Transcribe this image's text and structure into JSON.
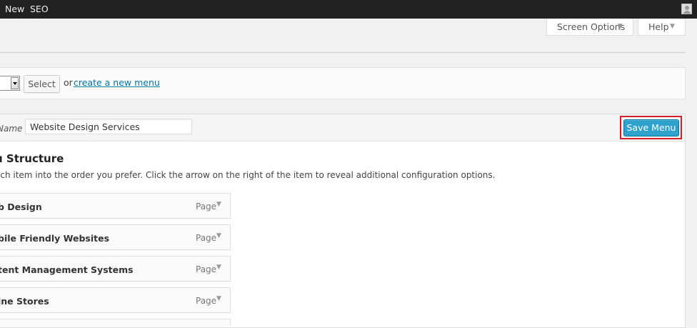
{
  "admin_bar": {
    "items": [
      "New",
      "SEO"
    ]
  },
  "screen_meta": {
    "screen_options_label": "Screen Options",
    "help_label": "Help",
    "arrow_glyph": "▼"
  },
  "manage": {
    "select_button_label": "Select",
    "or_text": "or",
    "create_link_text": "create a new menu",
    "period": "."
  },
  "editor": {
    "name_label": "Name",
    "menu_name_value": "Website Design Services",
    "save_button_label": "Save Menu",
    "structure_title": "u Structure",
    "instructions": "ach item into the order you prefer. Click the arrow on the right of the item to reveal additional configuration options.",
    "items": [
      {
        "title": "b Design",
        "type": "Page"
      },
      {
        "title": "bile Friendly Websites",
        "type": "Page"
      },
      {
        "title": "tent Management Systems",
        "type": "Page"
      },
      {
        "title": "ine Stores",
        "type": "Page"
      }
    ],
    "toggle_glyph": "▼"
  },
  "colors": {
    "admin_bar_bg": "#222222",
    "primary_button": "#2ea2cc",
    "link": "#0074a2",
    "highlight_border": "#d0202a"
  }
}
